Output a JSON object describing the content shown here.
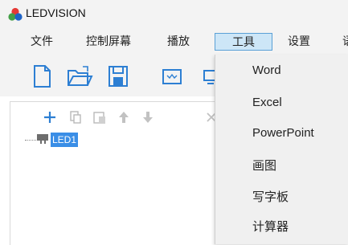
{
  "app": {
    "title": "LEDVISION"
  },
  "menubar": {
    "items": [
      {
        "label": "文件"
      },
      {
        "label": "控制屏幕"
      },
      {
        "label": "播放"
      },
      {
        "label": "工具"
      },
      {
        "label": "设置"
      },
      {
        "label": "语"
      }
    ],
    "active_index": 3
  },
  "toolbar": {
    "buttons": [
      "new-file-icon",
      "open-folder-icon",
      "save-icon",
      "display-icon",
      "monitor-icon"
    ]
  },
  "tree_toolbar": {
    "buttons": [
      "add-icon",
      "copy-icon",
      "paste-icon",
      "move-up-icon",
      "move-down-icon",
      "delete-icon"
    ]
  },
  "tree": {
    "node_label": "LED1"
  },
  "tools_menu": {
    "items": [
      {
        "label": "Word"
      },
      {
        "label": "Excel"
      },
      {
        "label": "PowerPoint"
      },
      {
        "label": "画图"
      },
      {
        "label": "写字板"
      },
      {
        "label": "计算器"
      }
    ]
  },
  "colors": {
    "accent": "#3a8ee6",
    "menu_highlight": "#cde6f7",
    "menu_border": "#5aa0d6"
  }
}
